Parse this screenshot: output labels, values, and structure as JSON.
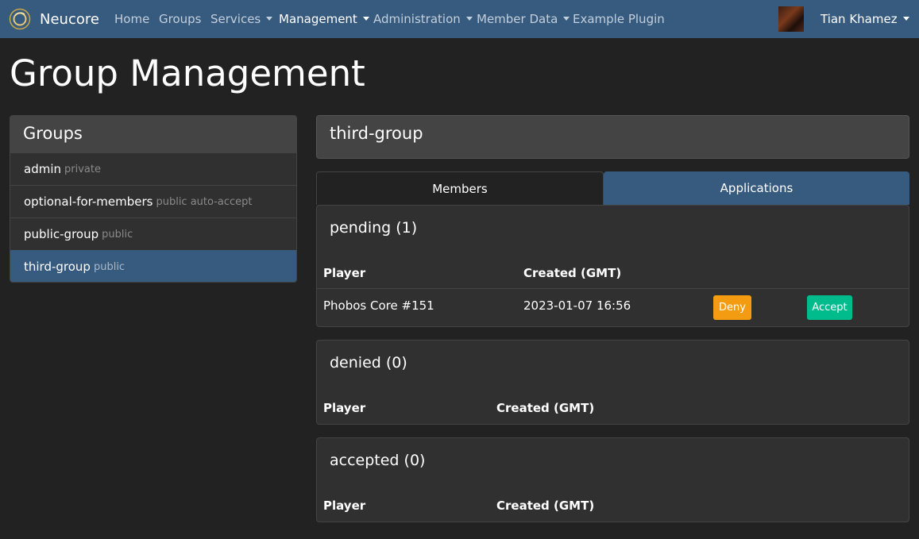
{
  "nav": {
    "brand": "Neucore",
    "items": [
      {
        "label": "Home"
      },
      {
        "label": "Groups"
      },
      {
        "label": "Services"
      },
      {
        "label": "Management"
      },
      {
        "label": "Administration"
      },
      {
        "label": "Member Data"
      },
      {
        "label": "Example Plugin"
      }
    ],
    "user": "Tian Khamez"
  },
  "page": {
    "title": "Group Management"
  },
  "groups": {
    "heading": "Groups",
    "items": [
      {
        "name": "admin",
        "meta": "private"
      },
      {
        "name": "optional-for-members",
        "meta": "public auto-accept"
      },
      {
        "name": "public-group",
        "meta": "public"
      },
      {
        "name": "third-group",
        "meta": "public"
      }
    ]
  },
  "selected_group": {
    "title": "third-group"
  },
  "tabs": {
    "members": "Members",
    "applications": "Applications"
  },
  "sections": {
    "pending": {
      "title": "pending (1)",
      "col_player": "Player",
      "col_created": "Created (GMT)",
      "rows": [
        {
          "player": "Phobos Core #151",
          "created": "2023-01-07 16:56",
          "deny": "Deny",
          "accept": "Accept"
        }
      ]
    },
    "denied": {
      "title": "denied (0)",
      "col_player": "Player",
      "col_created": "Created (GMT)"
    },
    "accepted": {
      "title": "accepted (0)",
      "col_player": "Player",
      "col_created": "Created (GMT)"
    }
  },
  "colors": {
    "navbar": "#375a7f",
    "background": "#222222",
    "deny": "#f39c12",
    "accept": "#00bc8c"
  }
}
